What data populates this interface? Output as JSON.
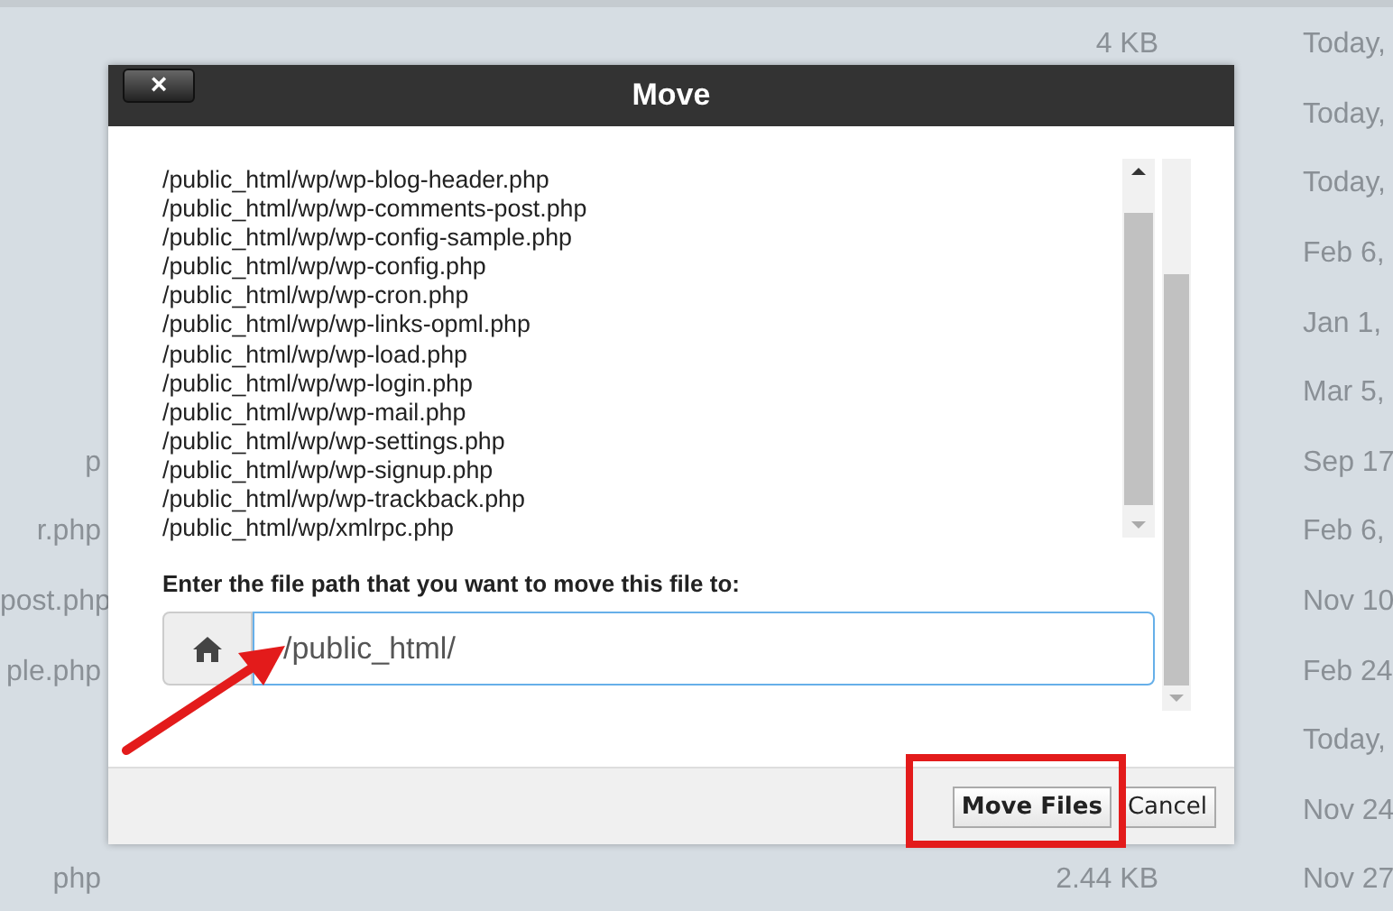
{
  "file_table": {
    "rows": [
      {
        "size": "4 KB",
        "date": "Today,"
      },
      {
        "date": "Today,"
      },
      {
        "date": "Today,"
      },
      {
        "date": "Feb 6,"
      },
      {
        "date": "Jan 1,"
      },
      {
        "date": "Mar 5,"
      },
      {
        "name": "p",
        "date": "Sep 17"
      },
      {
        "name": "r.php",
        "date": "Feb 6,"
      },
      {
        "name": "post.php",
        "date": "Nov 10"
      },
      {
        "name": "ple.php",
        "date": "Feb 24"
      },
      {
        "date": "Today,"
      },
      {
        "date": "Nov 24"
      },
      {
        "name": "php",
        "size": "2.44 KB",
        "date": "Nov 27"
      }
    ]
  },
  "dialog": {
    "title": "Move",
    "close": "×",
    "files": [
      "/public_html/wp/wp-blog-header.php",
      "/public_html/wp/wp-comments-post.php",
      "/public_html/wp/wp-config-sample.php",
      "/public_html/wp/wp-config.php",
      "/public_html/wp/wp-cron.php",
      "/public_html/wp/wp-links-opml.php",
      "/public_html/wp/wp-load.php",
      "/public_html/wp/wp-login.php",
      "/public_html/wp/wp-mail.php",
      "/public_html/wp/wp-settings.php",
      "/public_html/wp/wp-signup.php",
      "/public_html/wp/wp-trackback.php",
      "/public_html/wp/xmlrpc.php"
    ],
    "path_label": "Enter the file path that you want to move this file to:",
    "path_value": "/public_html/",
    "buttons": [
      "Move Files",
      "Cancel"
    ]
  }
}
